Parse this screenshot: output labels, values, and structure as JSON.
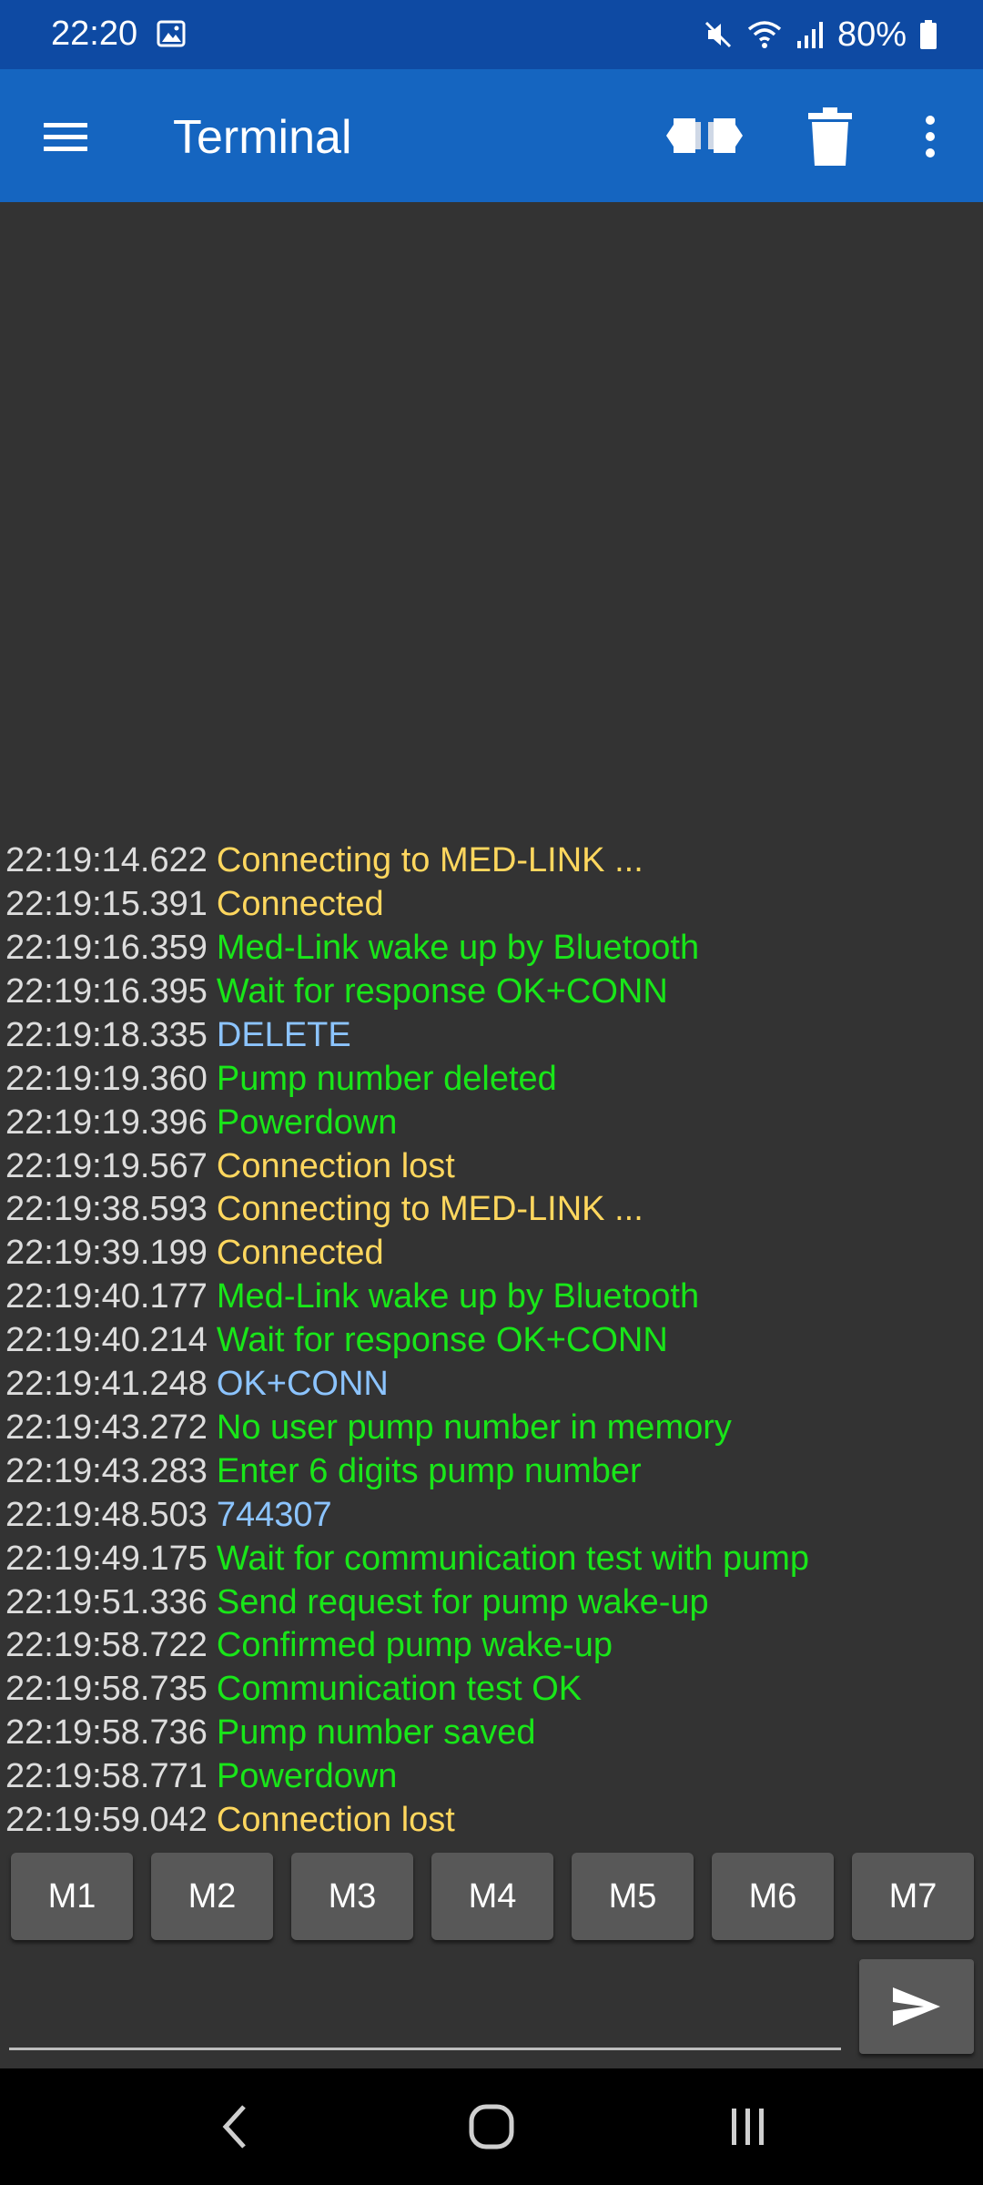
{
  "status_bar": {
    "time": "22:20",
    "battery": "80%",
    "icons": [
      "image-icon",
      "mute-icon",
      "wifi-icon",
      "signal-icon",
      "battery-icon"
    ]
  },
  "app_bar": {
    "title": "Terminal",
    "icons": [
      "menu-icon",
      "connect-icon",
      "trash-icon",
      "overflow-menu-icon"
    ],
    "color": "#1565c0"
  },
  "colors": {
    "status": "#ffd75e",
    "info": "#19e619",
    "data": "#8cc4ff",
    "timestamp": "#dddddd",
    "background": "#333333"
  },
  "log": [
    {
      "ts": "22:19:14.622",
      "msg": "Connecting to MED-LINK ...",
      "kind": "status"
    },
    {
      "ts": "22:19:15.391",
      "msg": "Connected",
      "kind": "status"
    },
    {
      "ts": "22:19:16.359",
      "msg": "Med-Link wake up by Bluetooth",
      "kind": "info"
    },
    {
      "ts": "22:19:16.395",
      "msg": "Wait for response OK+CONN",
      "kind": "info"
    },
    {
      "ts": "22:19:18.335",
      "msg": "DELETE",
      "kind": "data"
    },
    {
      "ts": "22:19:19.360",
      "msg": "Pump number deleted",
      "kind": "info"
    },
    {
      "ts": "22:19:19.396",
      "msg": "Powerdown",
      "kind": "info"
    },
    {
      "ts": "22:19:19.567",
      "msg": "Connection lost",
      "kind": "status"
    },
    {
      "ts": "22:19:38.593",
      "msg": "Connecting to MED-LINK ...",
      "kind": "status"
    },
    {
      "ts": "22:19:39.199",
      "msg": "Connected",
      "kind": "status"
    },
    {
      "ts": "22:19:40.177",
      "msg": "Med-Link wake up by Bluetooth",
      "kind": "info"
    },
    {
      "ts": "22:19:40.214",
      "msg": "Wait for response OK+CONN",
      "kind": "info"
    },
    {
      "ts": "22:19:41.248",
      "msg": "OK+CONN",
      "kind": "data"
    },
    {
      "ts": "22:19:43.272",
      "msg": "No user pump number in memory",
      "kind": "info"
    },
    {
      "ts": "22:19:43.283",
      "msg": "Enter 6 digits pump number",
      "kind": "info"
    },
    {
      "ts": "22:19:48.503",
      "msg": "744307",
      "kind": "data"
    },
    {
      "ts": "22:19:49.175",
      "msg": "Wait for communication test with pump",
      "kind": "info"
    },
    {
      "ts": "22:19:51.336",
      "msg": "Send request for pump wake-up",
      "kind": "info"
    },
    {
      "ts": "22:19:58.722",
      "msg": "Confirmed pump wake-up",
      "kind": "info"
    },
    {
      "ts": "22:19:58.735",
      "msg": "Communication test OK",
      "kind": "info"
    },
    {
      "ts": "22:19:58.736",
      "msg": "Pump number saved",
      "kind": "info"
    },
    {
      "ts": "22:19:58.771",
      "msg": "Powerdown",
      "kind": "info"
    },
    {
      "ts": "22:19:59.042",
      "msg": "Connection lost",
      "kind": "status"
    }
  ],
  "macros": [
    "M1",
    "M2",
    "M3",
    "M4",
    "M5",
    "M6",
    "M7"
  ],
  "input": {
    "value": "",
    "placeholder": ""
  },
  "send_icon": "send-icon",
  "nav": [
    "back-icon",
    "home-icon",
    "recents-icon"
  ]
}
